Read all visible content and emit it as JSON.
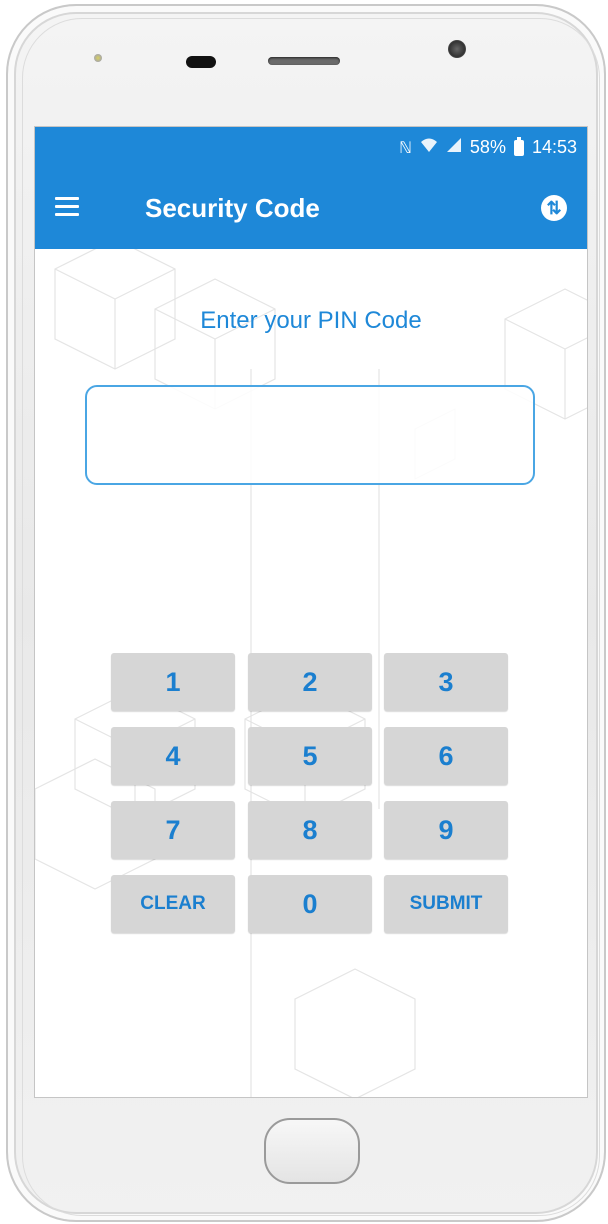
{
  "status_bar": {
    "nfc_icon": "nfc-icon",
    "wifi_icon": "wifi-icon",
    "signal_icon": "signal-icon",
    "battery_percent": "58%",
    "battery_icon": "battery-icon",
    "time": "14:53"
  },
  "app_bar": {
    "menu_icon": "hamburger-menu-icon",
    "title": "Security Code",
    "action_icon": "sync-icon"
  },
  "pin_screen": {
    "prompt": "Enter your PIN Code",
    "pin_value": ""
  },
  "keypad": {
    "keys": [
      "1",
      "2",
      "3",
      "4",
      "5",
      "6",
      "7",
      "8",
      "9",
      "CLEAR",
      "0",
      "SUBMIT"
    ]
  },
  "colors": {
    "primary": "#1e88d8",
    "key_background": "#d6d6d6",
    "key_text": "#1b7fcf"
  }
}
